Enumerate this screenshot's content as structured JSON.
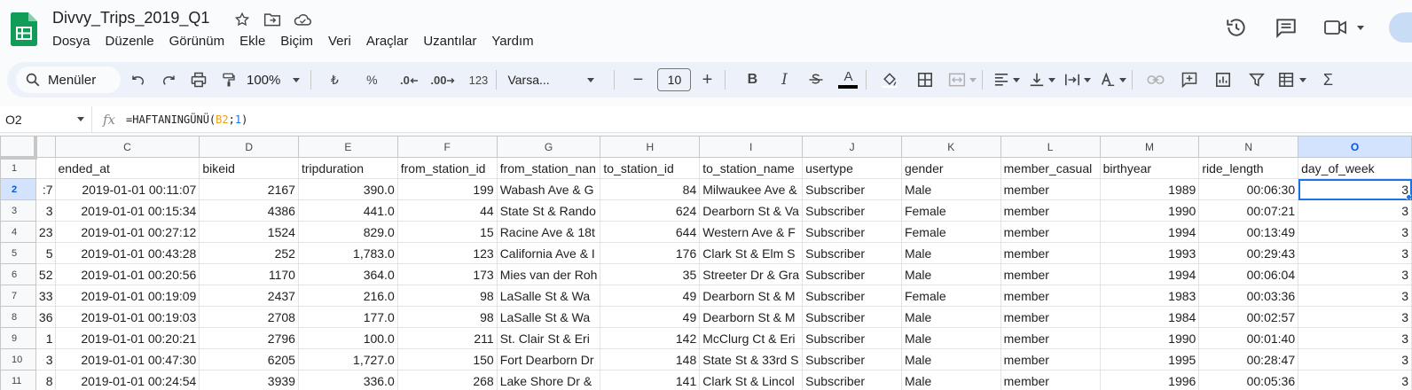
{
  "doc": {
    "title": "Divvy_Trips_2019_Q1"
  },
  "menu": [
    "Dosya",
    "Düzenle",
    "Görünüm",
    "Ekle",
    "Biçim",
    "Veri",
    "Araçlar",
    "Uzantılar",
    "Yardım"
  ],
  "toolbar": {
    "search_label": "Menüler",
    "zoom": "100%",
    "currency": "₺",
    "percent": "%",
    "dec_decrease": ".0",
    "dec_increase": ".00",
    "number_format": "123",
    "font": "Varsa...",
    "font_size": "10",
    "bold": "B",
    "italic": "I",
    "text_color": "A"
  },
  "formula_bar": {
    "cell_ref": "O2",
    "fx": "fx",
    "formula_prefix": "=HAFTANINGÜNÜ(",
    "formula_ref": "B2",
    "formula_sep": ";",
    "formula_num": "1",
    "formula_suffix": ")"
  },
  "columns": [
    "",
    "C",
    "D",
    "E",
    "F",
    "G",
    "H",
    "I",
    "J",
    "K",
    "L",
    "M",
    "N",
    "O"
  ],
  "selected_column": "O",
  "rows": [
    {
      "n": "1",
      "cells": [
        "",
        "ended_at",
        "bikeid",
        "tripduration",
        "from_station_id",
        "from_station_nan",
        "to_station_id",
        "to_station_name",
        "usertype",
        "gender",
        "member_casual",
        "birthyear",
        "ride_length",
        "day_of_week"
      ]
    },
    {
      "n": "2",
      "cells": ":7",
      "c": [
        "2019-01-01 00:11:07",
        "2167",
        "390.0",
        "199",
        "Wabash Ave & G",
        "84",
        "Milwaukee Ave &",
        "Subscriber",
        "Male",
        "member",
        "1989",
        "00:06:30",
        "3"
      ]
    },
    {
      "n": "3",
      "cells": "3",
      "c": [
        "2019-01-01 00:15:34",
        "4386",
        "441.0",
        "44",
        "State St & Rando",
        "624",
        "Dearborn St & Va",
        "Subscriber",
        "Female",
        "member",
        "1990",
        "00:07:21",
        "3"
      ]
    },
    {
      "n": "4",
      "cells": "23",
      "c": [
        "2019-01-01 00:27:12",
        "1524",
        "829.0",
        "15",
        "Racine Ave & 18t",
        "644",
        "Western Ave & F",
        "Subscriber",
        "Female",
        "member",
        "1994",
        "00:13:49",
        "3"
      ]
    },
    {
      "n": "5",
      "cells": "5",
      "c": [
        "2019-01-01 00:43:28",
        "252",
        "1,783.0",
        "123",
        "California Ave & I",
        "176",
        "Clark St & Elm S",
        "Subscriber",
        "Male",
        "member",
        "1993",
        "00:29:43",
        "3"
      ]
    },
    {
      "n": "6",
      "cells": "52",
      "c": [
        "2019-01-01 00:20:56",
        "1170",
        "364.0",
        "173",
        "Mies van der Roh",
        "35",
        "Streeter Dr & Gra",
        "Subscriber",
        "Male",
        "member",
        "1994",
        "00:06:04",
        "3"
      ]
    },
    {
      "n": "7",
      "cells": "33",
      "c": [
        "2019-01-01 00:19:09",
        "2437",
        "216.0",
        "98",
        "LaSalle St & Wa",
        "49",
        "Dearborn St & M",
        "Subscriber",
        "Female",
        "member",
        "1983",
        "00:03:36",
        "3"
      ]
    },
    {
      "n": "8",
      "cells": "36",
      "c": [
        "2019-01-01 00:19:03",
        "2708",
        "177.0",
        "98",
        "LaSalle St & Wa",
        "49",
        "Dearborn St & M",
        "Subscriber",
        "Male",
        "member",
        "1984",
        "00:02:57",
        "3"
      ]
    },
    {
      "n": "9",
      "cells": "1",
      "c": [
        "2019-01-01 00:20:21",
        "2796",
        "100.0",
        "211",
        "St. Clair St & Eri",
        "142",
        "McClurg Ct & Eri",
        "Subscriber",
        "Male",
        "member",
        "1990",
        "00:01:40",
        "3"
      ]
    },
    {
      "n": "10",
      "cells": "3",
      "c": [
        "2019-01-01 00:47:30",
        "6205",
        "1,727.0",
        "150",
        "Fort Dearborn Dr",
        "148",
        "State St & 33rd S",
        "Subscriber",
        "Male",
        "member",
        "1995",
        "00:28:47",
        "3"
      ]
    },
    {
      "n": "11",
      "cells": "8",
      "c": [
        "2019-01-01 00:24:54",
        "3939",
        "336.0",
        "268",
        "Lake Shore Dr &",
        "141",
        "Clark St & Lincol",
        "Subscriber",
        "Male",
        "member",
        "1996",
        "00:05:36",
        "3"
      ]
    }
  ]
}
